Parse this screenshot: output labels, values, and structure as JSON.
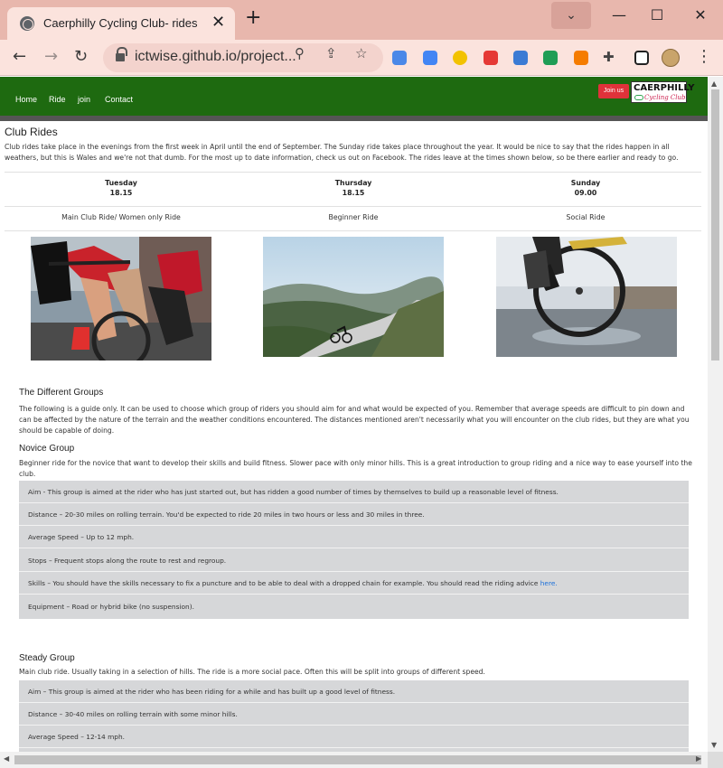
{
  "browser": {
    "tab_title": "Caerphilly Cycling Club- rides",
    "tab_close": "✕",
    "new_tab": "+",
    "url": "ictwise.github.io/project...",
    "window_controls": {
      "minimize": "—",
      "maximize": "☐",
      "close": "✕"
    },
    "nav": {
      "back": "←",
      "forward": "→",
      "reload": "↻"
    },
    "icons": [
      "globe-icon",
      "lock-icon",
      "zoom-icon",
      "share-icon",
      "star-icon",
      "extensions-icon",
      "sidepanel-icon",
      "menu-icon"
    ]
  },
  "site": {
    "nav": [
      "Home",
      "Ride",
      "join",
      "Contact"
    ],
    "join_button": "Join us",
    "logo_top": "CAERPHILLY",
    "logo_bottom": "Cycling Club"
  },
  "club_rides": {
    "title": "Club Rides",
    "intro": "Club rides take place in the evenings from the first week in April until the end of September. The Sunday ride takes place throughout the year. It would be nice to say that the rides happen in all weathers, but this is Wales and we're not that dumb. For the most up to date information, check us out on Facebook. The rides leave at the times shown below, so be there earlier and ready to go.",
    "schedule": [
      {
        "day": "Tuesday",
        "time": "18.15",
        "ride": "Main Club Ride/ Women only Ride"
      },
      {
        "day": "Thursday",
        "time": "18.15",
        "ride": "Beginner Ride"
      },
      {
        "day": "Sunday",
        "time": "09.00",
        "ride": "Social Ride"
      }
    ]
  },
  "groups": {
    "title": "The Different Groups",
    "intro": "The following is a guide only. It can be used to choose which group of riders you should aim for and what would be expected of you. Remember that average speeds are difficult to pin down and can be affected by the nature of the terrain and the weather conditions encountered. The distances mentioned aren't necessarily what you will encounter on the club rides, but they are what you should be capable of doing.",
    "novice": {
      "title": "Novice Group",
      "desc": "Beginner ride for the novice that want to develop their skills and build fitness. Slower pace with only minor hills. This is a great introduction to group riding and a nice way to ease yourself into the club.",
      "rows": [
        "Aim - This group is aimed at the rider who has just started out, but has ridden a good number of times by themselves to build up a reasonable level of fitness.",
        "Distance – 20-30 miles on rolling terrain. You'd be expected to ride 20 miles in two hours or less and 30 miles in three.",
        "Average Speed – Up to 12 mph.",
        "Stops – Frequent stops along the route to rest and regroup.",
        "Skills – You should have the skills necessary to fix a puncture and to be able to deal with a dropped chain for example. You should read the riding advice ",
        "Equipment – Road or hybrid bike (no suspension)."
      ],
      "link": "here."
    },
    "steady": {
      "title": "Steady Group",
      "desc": "Main club ride. Usually taking in a selection of hills. The ride is a more social pace. Often this will be split into groups of different speed.",
      "rows": [
        "Aim – This group is aimed at the rider who has been riding for a while and has built up a good level of fitness.",
        "Distance – 30-40 miles on rolling terrain with some minor hills.",
        "Average Speed – 12-14 mph."
      ]
    }
  }
}
